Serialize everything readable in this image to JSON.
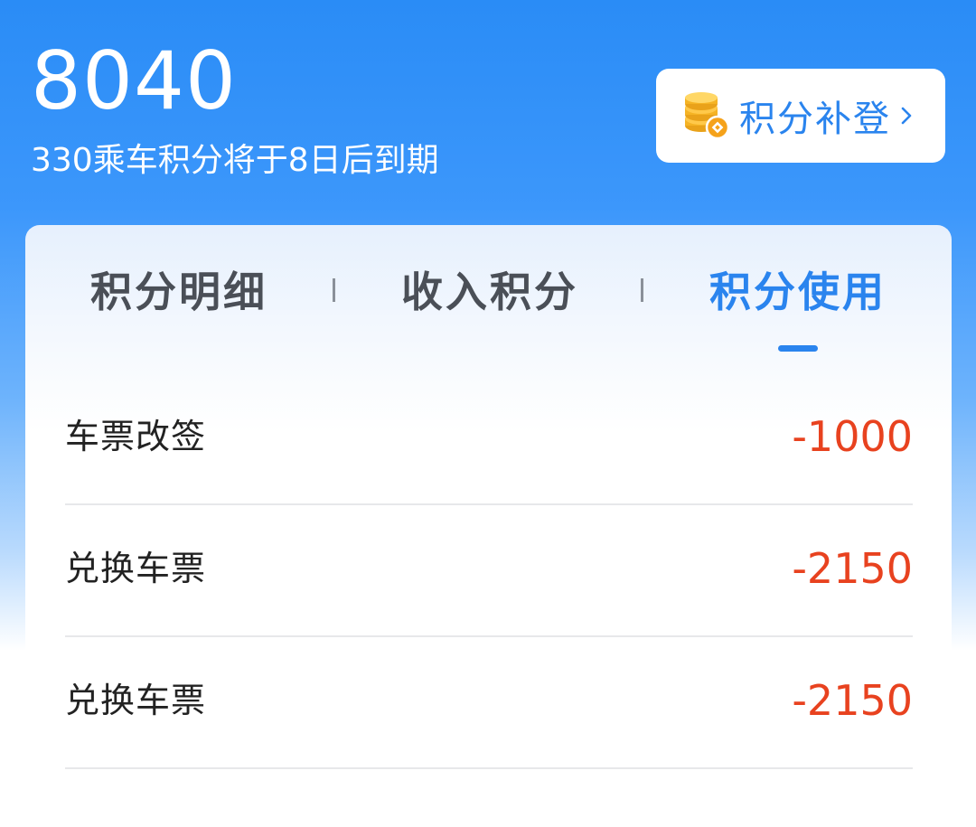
{
  "header": {
    "balance": "8040",
    "expire_note": "330乘车积分将于8日后到期",
    "supplement_button": {
      "label": "积分补登",
      "icon": "coin-stack-icon",
      "chevron": "chevron-right-icon"
    }
  },
  "tabs": [
    {
      "label": "积分明细",
      "active": false
    },
    {
      "label": "收入积分",
      "active": false
    },
    {
      "label": "积分使用",
      "active": true
    }
  ],
  "records": [
    {
      "title": "车票改签",
      "amount": "-1000"
    },
    {
      "title": "兑换车票",
      "amount": "-2150"
    },
    {
      "title": "兑换车票",
      "amount": "-2150"
    }
  ],
  "colors": {
    "header_blue": "#2a8cf6",
    "accent_blue": "#2a84ee",
    "amount_red": "#e8421f",
    "coin_gold": "#f5b324"
  }
}
